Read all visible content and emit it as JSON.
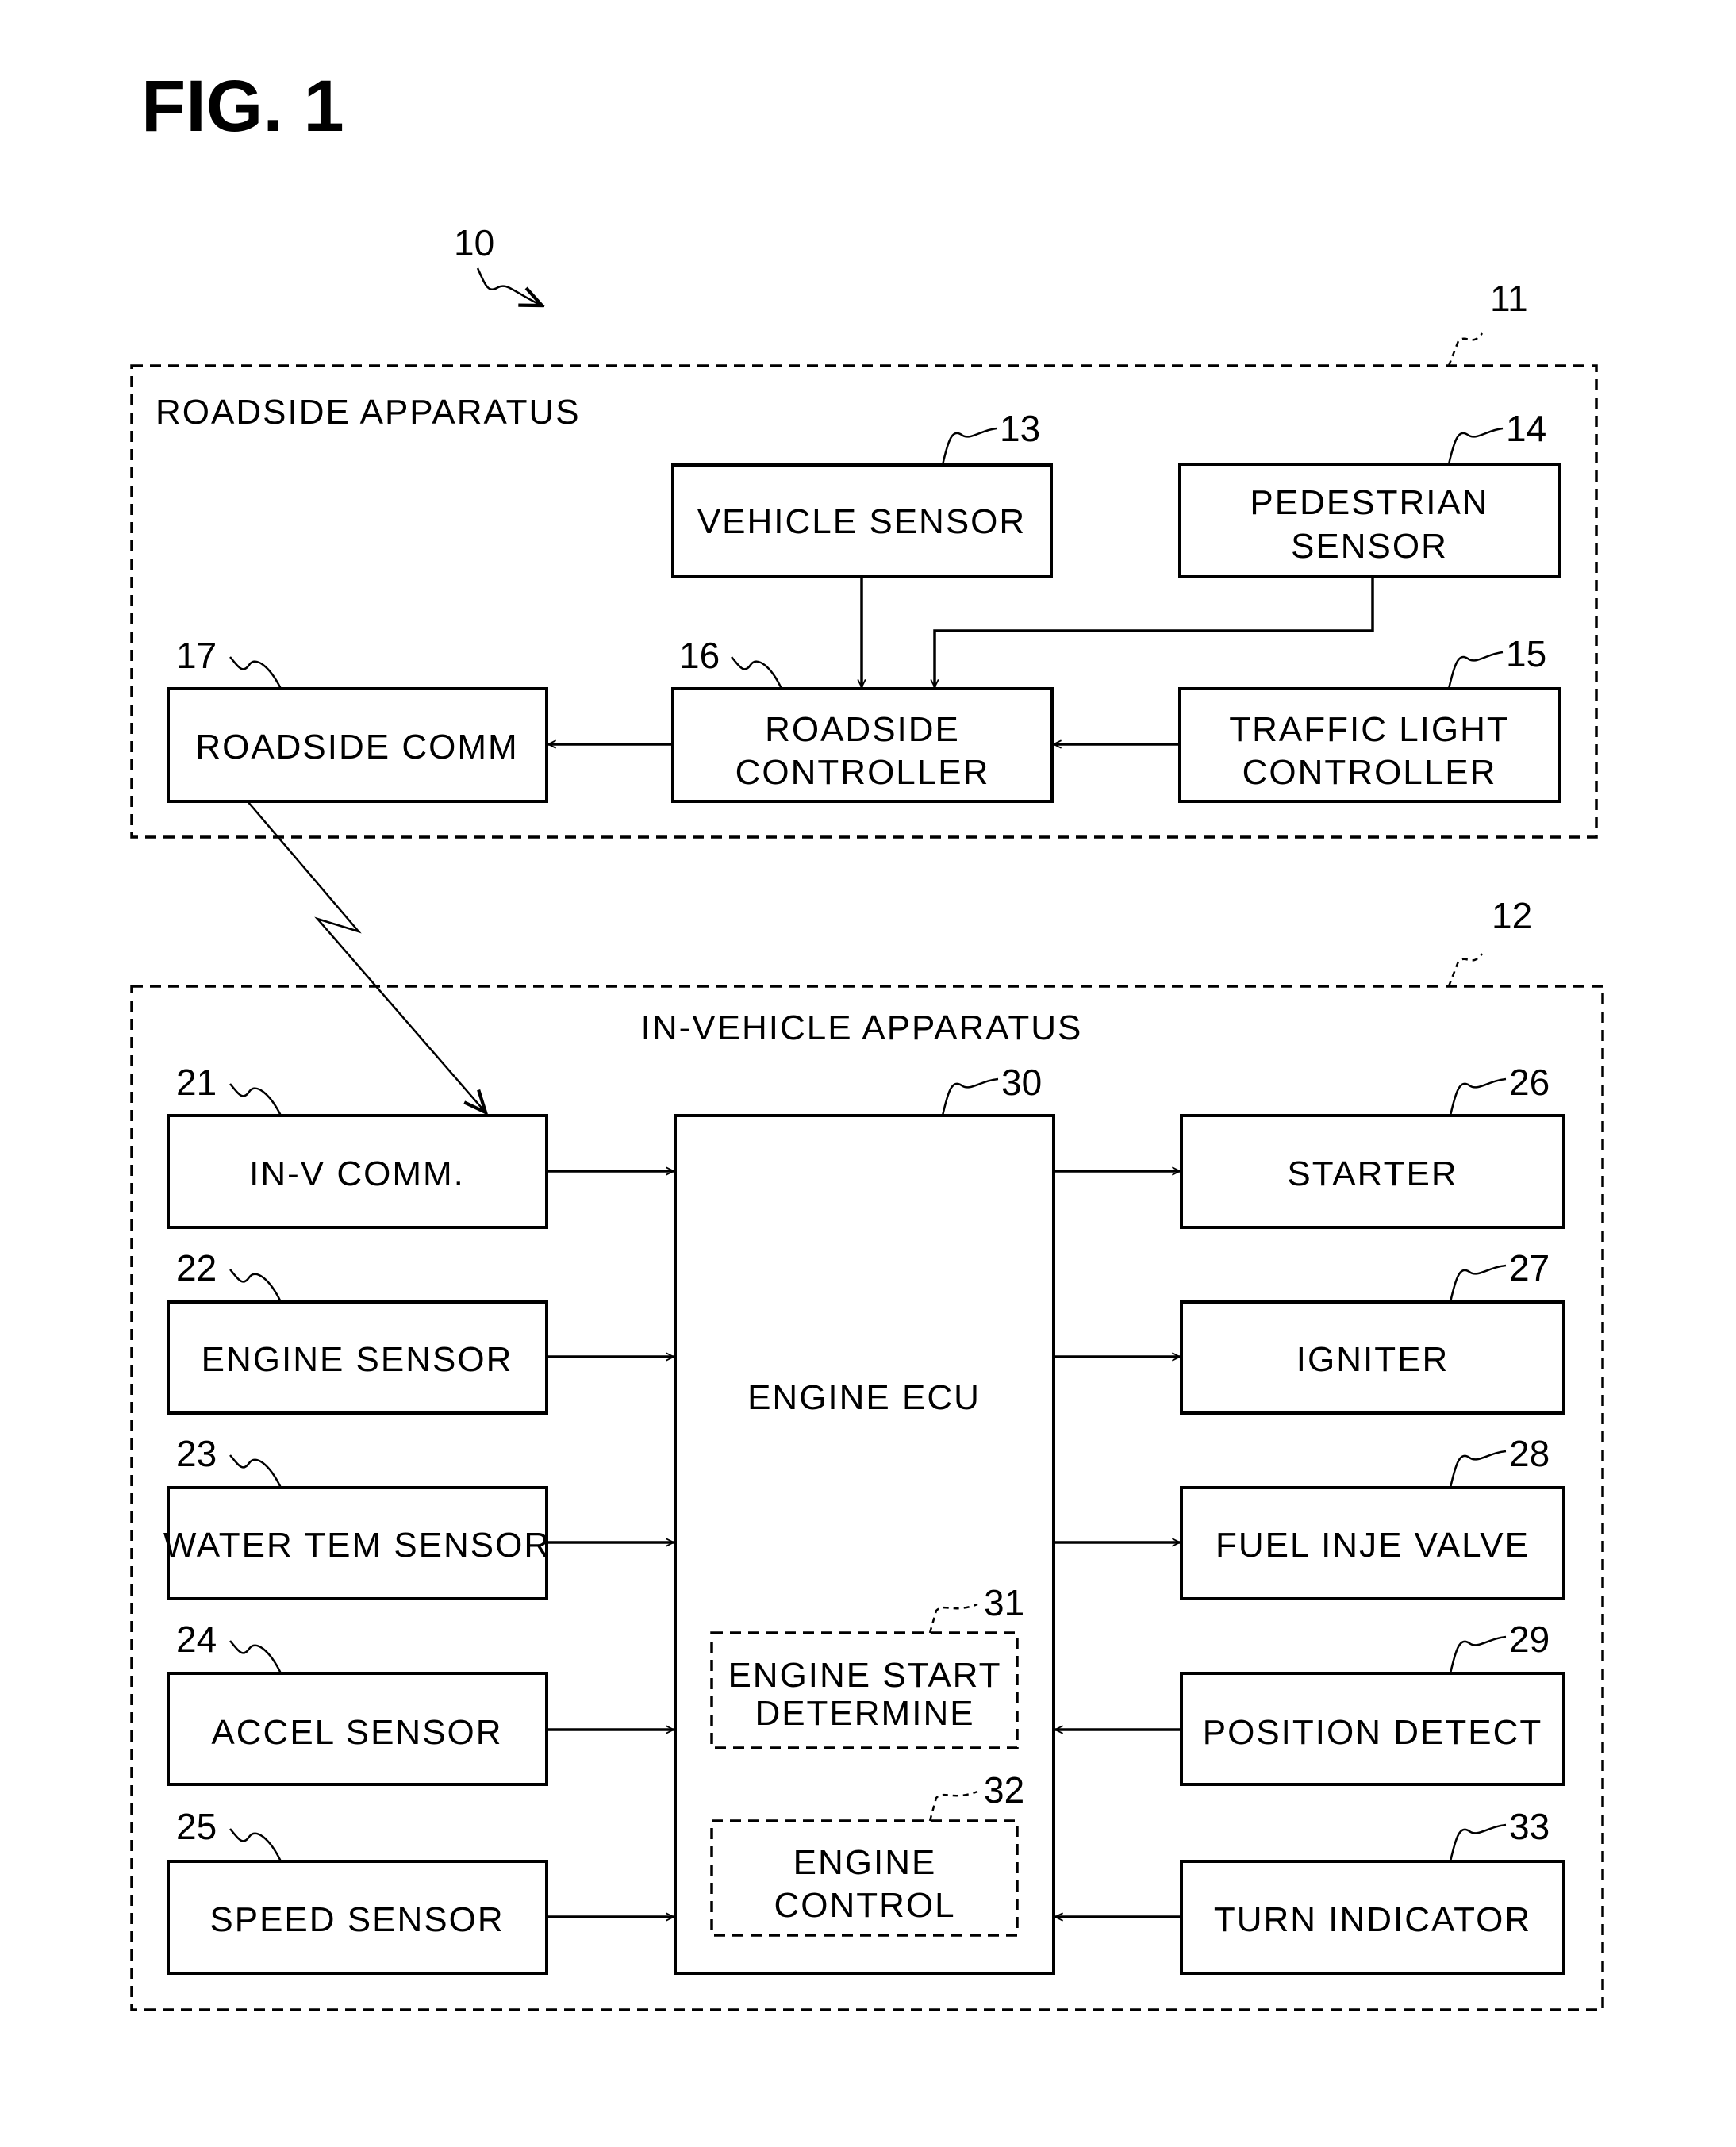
{
  "figure": {
    "title": "FIG. 1",
    "system_ref": "10"
  },
  "roadside": {
    "ref": "11",
    "title": "ROADSIDE APPARATUS",
    "blocks": {
      "vehicle_sensor": {
        "ref": "13",
        "lines": [
          "VEHICLE SENSOR"
        ]
      },
      "pedestrian_sensor": {
        "ref": "14",
        "lines": [
          "PEDESTRIAN",
          "SENSOR"
        ]
      },
      "traffic_light_controller": {
        "ref": "15",
        "lines": [
          "TRAFFIC LIGHT",
          "CONTROLLER"
        ]
      },
      "roadside_controller": {
        "ref": "16",
        "lines": [
          "ROADSIDE",
          "CONTROLLER"
        ]
      },
      "roadside_comm": {
        "ref": "17",
        "lines": [
          "ROADSIDE COMM"
        ]
      }
    }
  },
  "in_vehicle": {
    "ref": "12",
    "title": "IN-VEHICLE APPARATUS",
    "inputs": [
      {
        "ref": "21",
        "label": "IN-V COMM."
      },
      {
        "ref": "22",
        "label": "ENGINE SENSOR"
      },
      {
        "ref": "23",
        "label": "WATER TEM SENSOR"
      },
      {
        "ref": "24",
        "label": "ACCEL SENSOR"
      },
      {
        "ref": "25",
        "label": "SPEED SENSOR"
      }
    ],
    "ecu": {
      "ref": "30",
      "label": "ENGINE ECU",
      "modules": [
        {
          "ref": "31",
          "lines": [
            "ENGINE START",
            "DETERMINE"
          ]
        },
        {
          "ref": "32",
          "lines": [
            "ENGINE",
            "CONTROL"
          ]
        }
      ]
    },
    "right": [
      {
        "ref": "26",
        "label": "STARTER",
        "direction": "output"
      },
      {
        "ref": "27",
        "label": "IGNITER",
        "direction": "output"
      },
      {
        "ref": "28",
        "label": "FUEL INJE VALVE",
        "direction": "output"
      },
      {
        "ref": "29",
        "label": "POSITION DETECT",
        "direction": "input"
      },
      {
        "ref": "33",
        "label": "TURN INDICATOR",
        "direction": "input"
      }
    ]
  }
}
